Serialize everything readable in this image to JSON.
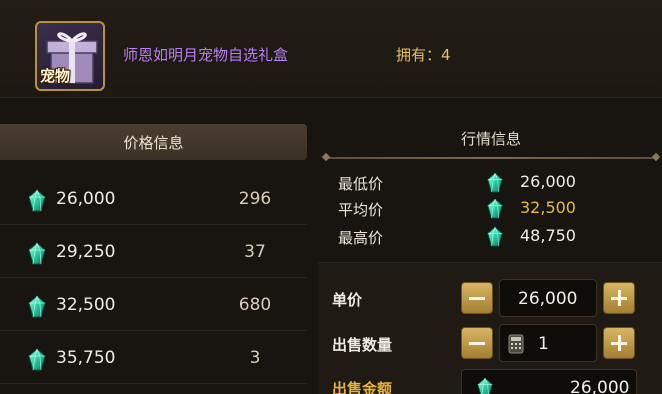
{
  "item": {
    "name": "师恩如明月宠物自选礼盒",
    "tag": "宠物",
    "owned_label": "拥有：4"
  },
  "price_panel": {
    "title": "价格信息",
    "rows": [
      {
        "price": "26,000",
        "count": "296"
      },
      {
        "price": "29,250",
        "count": "37"
      },
      {
        "price": "32,500",
        "count": "680"
      },
      {
        "price": "35,750",
        "count": "3"
      }
    ]
  },
  "market": {
    "title": "行情信息",
    "min_label": "最低价",
    "min_value": "26,000",
    "avg_label": "平均价",
    "avg_value": "32,500",
    "max_label": "最高价",
    "max_value": "48,750"
  },
  "sell": {
    "unit_price_label": "单价",
    "unit_price_value": "26,000",
    "quantity_label": "出售数量",
    "quantity_value": "1",
    "total_label": "出售金额",
    "total_value": "26,000"
  },
  "colors": {
    "gem": "#2fd6a8",
    "gold_accent": "#e8b338",
    "item_name": "#b77ff0"
  }
}
